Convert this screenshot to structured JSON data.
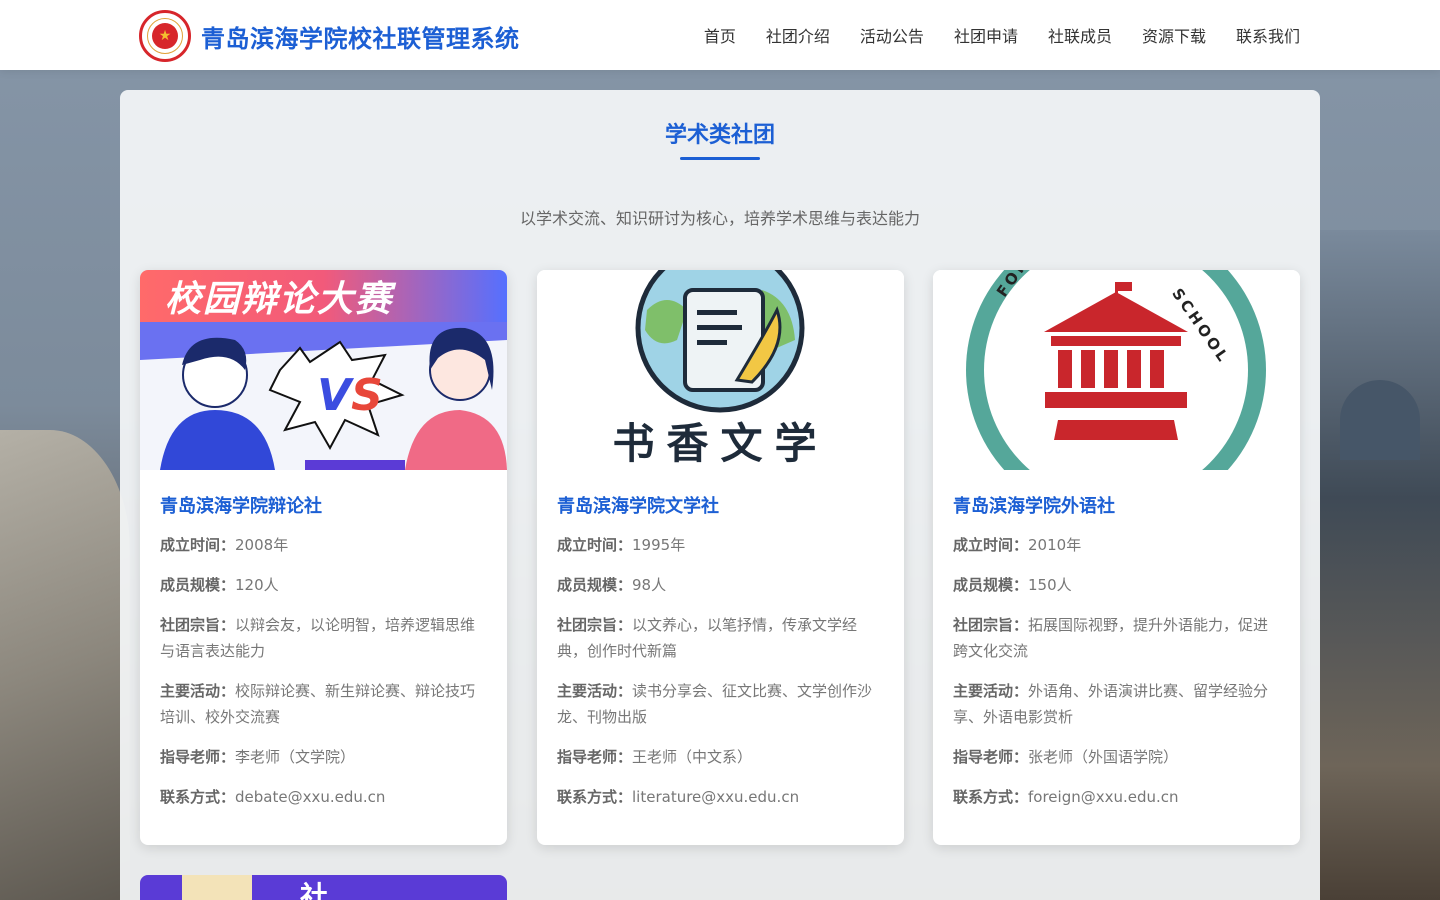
{
  "header": {
    "logo_icon": "school-emblem-icon",
    "site_title": "青岛滨海学院校社联管理系统",
    "nav": [
      {
        "label": "首页"
      },
      {
        "label": "社团介绍"
      },
      {
        "label": "活动公告"
      },
      {
        "label": "社团申请"
      },
      {
        "label": "社联成员"
      },
      {
        "label": "资源下载"
      },
      {
        "label": "联系我们"
      }
    ]
  },
  "section": {
    "title": "学术类社团",
    "subtitle": "以学术交流、知识研讨为核心，培养学术思维与表达能力"
  },
  "labels": {
    "founded": "成立时间：",
    "members": "成员规模：",
    "purpose": "社团宗旨：",
    "activities": "主要活动：",
    "advisor": "指导老师：",
    "contact": "联系方式："
  },
  "clubs": [
    {
      "name": "青岛滨海学院辩论社",
      "cover_text": "校园辩论大赛",
      "cover_vs": "VS",
      "founded": "2008年",
      "members": "120人",
      "purpose": "以辩会友，以论明智，培养逻辑思维与语言表达能力",
      "activities": "校际辩论赛、新生辩论赛、辩论技巧培训、校外交流赛",
      "advisor": "李老师（文学院）",
      "contact": "debate@xxu.edu.cn"
    },
    {
      "name": "青岛滨海学院文学社",
      "cover_text": "书香文学",
      "founded": "1995年",
      "members": "98人",
      "purpose": "以文养心，以笔抒情，传承文学经典，创作时代新篇",
      "activities": "读书分享会、征文比赛、文学创作沙龙、刊物出版",
      "advisor": "王老师（中文系）",
      "contact": "literature@xxu.edu.cn"
    },
    {
      "name": "青岛滨海学院外语社",
      "cover_text_left": "FOREIGN",
      "cover_text_right": "SCHOOL",
      "founded": "2010年",
      "members": "150人",
      "purpose": "拓展国际视野，提升外语能力，促进跨文化交流",
      "activities": "外语角、外语演讲比赛、留学经验分享、外语电影赏析",
      "advisor": "张老师（外国语学院）",
      "contact": "foreign@xxu.edu.cn"
    }
  ],
  "partial_card": {
    "cover_text": "社"
  },
  "colors": {
    "accent": "#1c5fd4",
    "emblem_red": "#d7262b"
  }
}
